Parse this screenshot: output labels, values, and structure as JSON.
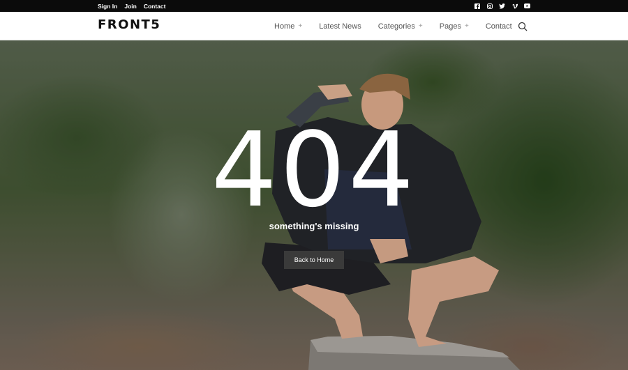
{
  "topbar": {
    "links": [
      "Sign In",
      "Join",
      "Contact"
    ],
    "socials": [
      "facebook-icon",
      "instagram-icon",
      "twitter-icon",
      "vimeo-icon",
      "youtube-icon"
    ]
  },
  "header": {
    "logo": "FRONT5",
    "nav": [
      {
        "label": "Home",
        "has_submenu": true
      },
      {
        "label": "Latest News",
        "has_submenu": false
      },
      {
        "label": "Categories",
        "has_submenu": true
      },
      {
        "label": "Pages",
        "has_submenu": true
      },
      {
        "label": "Contact",
        "has_submenu": false
      }
    ],
    "plus": "+"
  },
  "hero": {
    "code": "404",
    "message": "something's missing",
    "button_label": "Back to Home"
  },
  "colors": {
    "topbar_bg": "#0b0b0b",
    "button_bg": "#3a3a3a"
  }
}
